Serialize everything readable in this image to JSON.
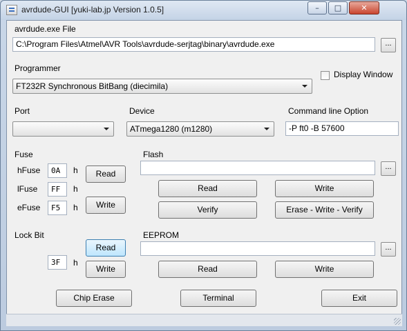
{
  "window": {
    "title": "avrdude-GUI [yuki-lab.jp Version 1.0.5]",
    "minimize": "–",
    "maximize": "□",
    "close": "✕"
  },
  "avrdude": {
    "label": "avrdude.exe File",
    "path": "C:\\Program Files\\Atmel\\AVR Tools\\avrdude-serjtag\\binary\\avrdude.exe",
    "browse": "..."
  },
  "programmer": {
    "label": "Programmer",
    "value": "FT232R Synchronous BitBang (diecimila)",
    "display_window_label": "Display Window",
    "display_window_checked": false
  },
  "port": {
    "label": "Port",
    "value": ""
  },
  "device": {
    "label": "Device",
    "value": "ATmega1280 (m1280)"
  },
  "command": {
    "label": "Command line Option",
    "value": "-P ft0 -B 57600"
  },
  "fuse": {
    "label": "Fuse",
    "hfuse_label": "hFuse",
    "hfuse": "0A",
    "lfuse_label": "lFuse",
    "lfuse": "FF",
    "efuse_label": "eFuse",
    "efuse": "F5",
    "h": "h",
    "read": "Read",
    "write": "Write"
  },
  "flash": {
    "label": "Flash",
    "file": "",
    "browse": "...",
    "read": "Read",
    "write": "Write",
    "verify": "Verify",
    "erase_write_verify": "Erase - Write - Verify"
  },
  "lockbit": {
    "label": "Lock Bit",
    "value": "3F",
    "h": "h",
    "read": "Read",
    "write": "Write"
  },
  "eeprom": {
    "label": "EEPROM",
    "file": "",
    "browse": "...",
    "read": "Read",
    "write": "Write"
  },
  "bottom": {
    "chip_erase": "Chip Erase",
    "terminal": "Terminal",
    "exit": "Exit"
  }
}
